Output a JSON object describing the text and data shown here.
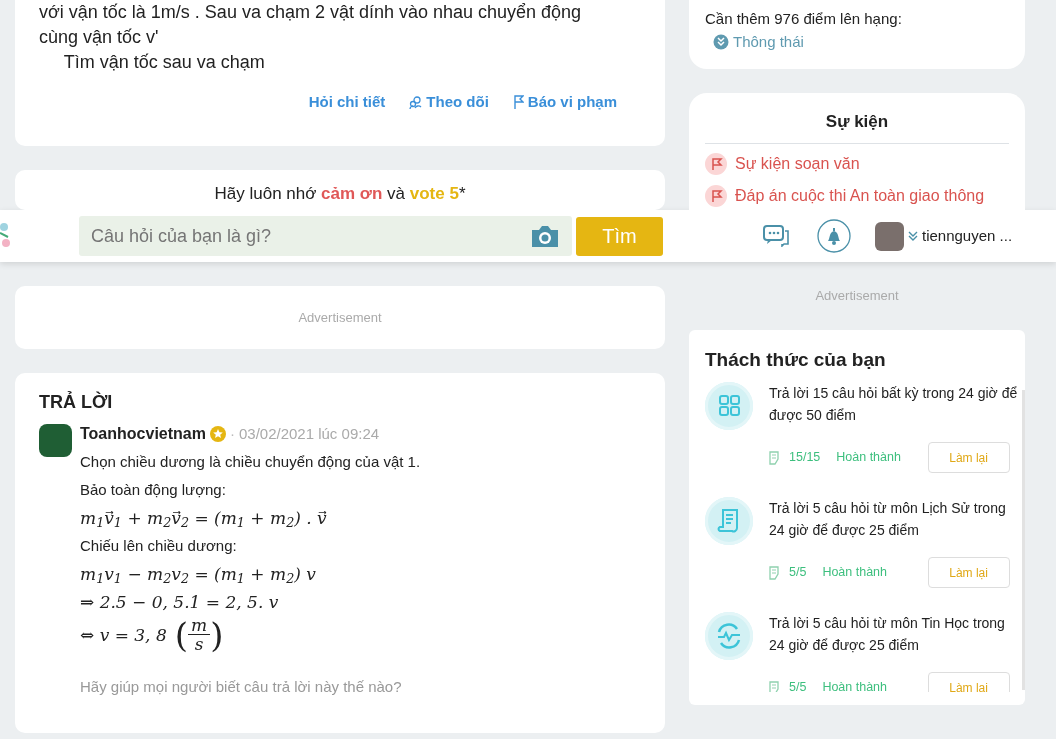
{
  "question": {
    "lines": [
      "với vận tốc là 1m/s . Sau va chạm 2 vật dính vào nhau chuyển động",
      "cùng vận tốc v'",
      "     Tìm vận tốc sau va chạm"
    ],
    "actions": [
      {
        "kind": "text",
        "label": "Hỏi chi tiết"
      },
      {
        "kind": "follow",
        "label": "Theo dõi"
      },
      {
        "kind": "report",
        "label": "Báo vi phạm"
      }
    ]
  },
  "reminder": "Hãy luôn nhớ **cảm ơn** và **vote 5***",
  "rank": {
    "text": "Cần thêm 976 điểm lên hạng:",
    "level": "Thông thái"
  },
  "events": {
    "title": "Sự kiện",
    "items": [
      "Sự kiện soạn văn",
      "Đáp án cuộc thi An toàn giao thông"
    ]
  },
  "header": {
    "search": {
      "placeholder": "Câu hỏi của bạn là gì?"
    },
    "search_button": "Tìm",
    "username": "tiennguyen ..."
  },
  "ads": {
    "left": "Advertisement",
    "right": "Advertisement"
  },
  "answer": {
    "title": "TRẢ LỜI",
    "author": "Toanhocvietnam",
    "separator": "·",
    "date": "03/02/2021 lúc 09:24",
    "lines": [
      {
        "kind": "text",
        "text": "Chọn chiều dương là chiều chuyển động của vật 1."
      },
      {
        "kind": "text",
        "text": "Bảo toàn động lượng:"
      },
      {
        "kind": "math",
        "text": "m$_{1}$v⃗$_{1}$ + m$_{2}$v⃗$_{2}$ = (m$_{1}$ + m$_{2}$) . v⃗"
      },
      {
        "kind": "text",
        "text": "Chiếu lên chiều dương:"
      },
      {
        "kind": "math",
        "text": "m$_{1}$v$_{1}$ − m$_{2}$v$_{2}$ = (m$_{1}$ + m$_{2}$) v"
      },
      {
        "kind": "math",
        "text": "⇒ 2.5 − 0, 5.1 = 2, 5. v"
      },
      {
        "kind": "fraction",
        "prefix": "⇔ v = 3, 8",
        "open": "(",
        "numerator": "m",
        "denominator": "s",
        "close": ")"
      }
    ],
    "feedback": "Hãy giúp mọi người biết câu trả lời này thế nào?"
  },
  "challenges": {
    "title": "Thách thức của bạn",
    "items": [
      {
        "kind": "grid",
        "text": "Trả lời 15 câu hỏi  bất kỳ  trong 24 giờ để được 50 điểm",
        "count": "15/15",
        "status": "Hoàn thành",
        "button": "Làm lại"
      },
      {
        "kind": "scroll",
        "text": "Trả lời 5 câu hỏi  từ môn Lịch Sử trong 24 giờ để được 25 điểm",
        "count": "5/5",
        "status": "Hoàn thành",
        "button": "Làm lại"
      },
      {
        "kind": "pulse",
        "text": "Trả lời 5 câu hỏi  từ môn Tin Học trong 24 giờ để được 25 điểm",
        "count": "5/5",
        "status": "Hoàn thành",
        "button": "Làm lại"
      }
    ]
  }
}
